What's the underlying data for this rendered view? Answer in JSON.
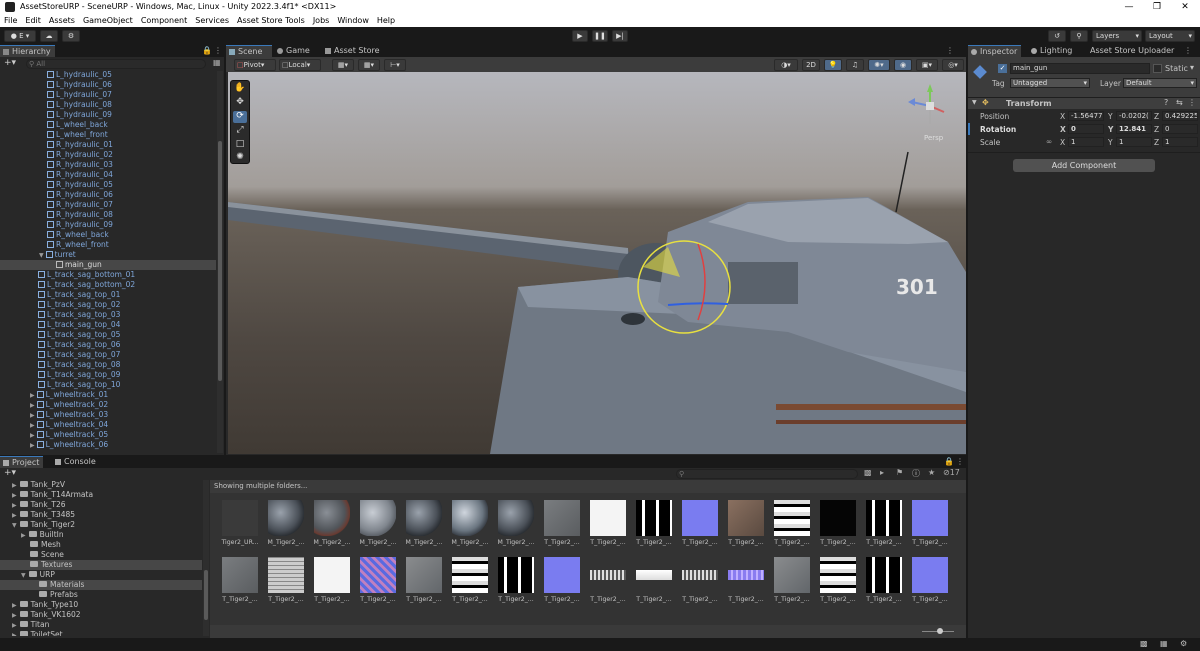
{
  "window": {
    "title": "AssetStoreURP - SceneURP - Windows, Mac, Linux - Unity 2022.3.4f1* <DX11>"
  },
  "menu": [
    "File",
    "Edit",
    "Assets",
    "GameObject",
    "Component",
    "Services",
    "Asset Store Tools",
    "Jobs",
    "Window",
    "Help"
  ],
  "toolbar": {
    "account": "E",
    "layers": "Layers",
    "layout": "Layout"
  },
  "hierarchy": {
    "tab": "Hierarchy",
    "search_placeholder": "All",
    "items": [
      {
        "label": "L_hydraulic_05",
        "indent": 3
      },
      {
        "label": "L_hydraulic_06",
        "indent": 3
      },
      {
        "label": "L_hydraulic_07",
        "indent": 3
      },
      {
        "label": "L_hydraulic_08",
        "indent": 3
      },
      {
        "label": "L_hydraulic_09",
        "indent": 3
      },
      {
        "label": "L_wheel_back",
        "indent": 3
      },
      {
        "label": "L_wheel_front",
        "indent": 3
      },
      {
        "label": "R_hydraulic_01",
        "indent": 3
      },
      {
        "label": "R_hydraulic_02",
        "indent": 3
      },
      {
        "label": "R_hydraulic_03",
        "indent": 3
      },
      {
        "label": "R_hydraulic_04",
        "indent": 3
      },
      {
        "label": "R_hydraulic_05",
        "indent": 3
      },
      {
        "label": "R_hydraulic_06",
        "indent": 3
      },
      {
        "label": "R_hydraulic_07",
        "indent": 3
      },
      {
        "label": "R_hydraulic_08",
        "indent": 3
      },
      {
        "label": "R_hydraulic_09",
        "indent": 3
      },
      {
        "label": "R_wheel_back",
        "indent": 3
      },
      {
        "label": "R_wheel_front",
        "indent": 3
      },
      {
        "label": "turret",
        "indent": 3,
        "arrow": "▼"
      },
      {
        "label": "main_gun",
        "indent": 4,
        "selected": true
      },
      {
        "label": "L_track_sag_bottom_01",
        "indent": 2
      },
      {
        "label": "L_track_sag_bottom_02",
        "indent": 2
      },
      {
        "label": "L_track_sag_top_01",
        "indent": 2
      },
      {
        "label": "L_track_sag_top_02",
        "indent": 2
      },
      {
        "label": "L_track_sag_top_03",
        "indent": 2
      },
      {
        "label": "L_track_sag_top_04",
        "indent": 2
      },
      {
        "label": "L_track_sag_top_05",
        "indent": 2
      },
      {
        "label": "L_track_sag_top_06",
        "indent": 2
      },
      {
        "label": "L_track_sag_top_07",
        "indent": 2
      },
      {
        "label": "L_track_sag_top_08",
        "indent": 2
      },
      {
        "label": "L_track_sag_top_09",
        "indent": 2
      },
      {
        "label": "L_track_sag_top_10",
        "indent": 2
      },
      {
        "label": "L_wheeltrack_01",
        "indent": 2,
        "arrow": "▶"
      },
      {
        "label": "L_wheeltrack_02",
        "indent": 2,
        "arrow": "▶"
      },
      {
        "label": "L_wheeltrack_03",
        "indent": 2,
        "arrow": "▶"
      },
      {
        "label": "L_wheeltrack_04",
        "indent": 2,
        "arrow": "▶"
      },
      {
        "label": "L_wheeltrack_05",
        "indent": 2,
        "arrow": "▶"
      },
      {
        "label": "L_wheeltrack_06",
        "indent": 2,
        "arrow": "▶"
      }
    ]
  },
  "scene": {
    "tabs": [
      "Scene",
      "Game",
      "Asset Store"
    ],
    "pivot": "Pivot",
    "local": "Local",
    "mode_2d": "2D",
    "gizmo_label": "Persp",
    "turret_number": "301"
  },
  "inspector": {
    "tabs": [
      "Inspector",
      "Lighting",
      "Asset Store Uploader"
    ],
    "object_name": "main_gun",
    "static_label": "Static",
    "tag_label": "Tag",
    "tag_value": "Untagged",
    "layer_label": "Layer",
    "layer_value": "Default",
    "component": "Transform",
    "position_label": "Position",
    "rotation_label": "Rotation",
    "scale_label": "Scale",
    "position": {
      "x": "-1.56477",
      "y": "-0.0202(",
      "z": "0.429225"
    },
    "rotation": {
      "x": "0",
      "y": "12.841",
      "z": "0"
    },
    "scale": {
      "x": "1",
      "y": "1",
      "z": "1"
    },
    "add_component": "Add Component"
  },
  "project": {
    "tabs": [
      "Project",
      "Console"
    ],
    "folders": [
      {
        "label": "Tank_PzV",
        "indent": 1,
        "arrow": "▶"
      },
      {
        "label": "Tank_T14Armata",
        "indent": 1,
        "arrow": "▶"
      },
      {
        "label": "Tank_T26",
        "indent": 1,
        "arrow": "▶"
      },
      {
        "label": "Tank_T3485",
        "indent": 1,
        "arrow": "▶"
      },
      {
        "label": "Tank_Tiger2",
        "indent": 1,
        "arrow": "▼"
      },
      {
        "label": "BuiltIn",
        "indent": 2,
        "arrow": "▶"
      },
      {
        "label": "Mesh",
        "indent": 2
      },
      {
        "label": "Scene",
        "indent": 2
      },
      {
        "label": "Textures",
        "indent": 2,
        "selected": true
      },
      {
        "label": "URP",
        "indent": 2,
        "arrow": "▼"
      },
      {
        "label": "Materials",
        "indent": 3,
        "selected": true
      },
      {
        "label": "Prefabs",
        "indent": 3
      },
      {
        "label": "Tank_Type10",
        "indent": 1,
        "arrow": "▶"
      },
      {
        "label": "Tank_VK1602",
        "indent": 1,
        "arrow": "▶"
      },
      {
        "label": "Titan",
        "indent": 1,
        "arrow": "▶"
      },
      {
        "label": "ToiletSet",
        "indent": 1,
        "arrow": "▶"
      }
    ],
    "breadcrumb": "Showing multiple folders...",
    "visible_count": "17",
    "assets_row1": [
      {
        "label": "Tiger2_UR...",
        "kind": "mesh"
      },
      {
        "label": "M_Tiger2_...",
        "kind": "sphere"
      },
      {
        "label": "M_Tiger2_...",
        "kind": "sphere2"
      },
      {
        "label": "M_Tiger2_...",
        "kind": "sphere3"
      },
      {
        "label": "M_Tiger2_...",
        "kind": "sphere"
      },
      {
        "label": "M_Tiger2_...",
        "kind": "sphere4"
      },
      {
        "label": "M_Tiger2_...",
        "kind": "sphere"
      },
      {
        "label": "T_Tiger2_...",
        "kind": "grey"
      },
      {
        "label": "T_Tiger2_...",
        "kind": "white"
      },
      {
        "label": "T_Tiger2_...",
        "kind": "bw"
      },
      {
        "label": "T_Tiger2_...",
        "kind": "normal"
      },
      {
        "label": "T_Tiger2_...",
        "kind": "rust"
      },
      {
        "label": "T_Tiger2_...",
        "kind": "bw2"
      },
      {
        "label": "T_Tiger2_...",
        "kind": "black"
      },
      {
        "label": "T_Tiger2_...",
        "kind": "bw"
      },
      {
        "label": "T_Tiger2_...",
        "kind": "normal"
      }
    ],
    "assets_row2": [
      {
        "label": "T_Tiger2_...",
        "kind": "grey"
      },
      {
        "label": "T_Tiger2_...",
        "kind": "grid"
      },
      {
        "label": "T_Tiger2_...",
        "kind": "white"
      },
      {
        "label": "T_Tiger2_...",
        "kind": "pattern"
      },
      {
        "label": "T_Tiger2_...",
        "kind": "grey2"
      },
      {
        "label": "T_Tiger2_...",
        "kind": "bw2"
      },
      {
        "label": "T_Tiger2_...",
        "kind": "bw"
      },
      {
        "label": "T_Tiger2_...",
        "kind": "normal"
      },
      {
        "label": "T_Tiger2_...",
        "kind": "strip"
      },
      {
        "label": "T_Tiger2_...",
        "kind": "strip2"
      },
      {
        "label": "T_Tiger2_...",
        "kind": "strip"
      },
      {
        "label": "T_Tiger2_...",
        "kind": "strip3"
      },
      {
        "label": "T_Tiger2_...",
        "kind": "grey2"
      },
      {
        "label": "T_Tiger2_...",
        "kind": "bw2"
      },
      {
        "label": "T_Tiger2_...",
        "kind": "bw"
      },
      {
        "label": "T_Tiger2_...",
        "kind": "normal"
      }
    ]
  }
}
